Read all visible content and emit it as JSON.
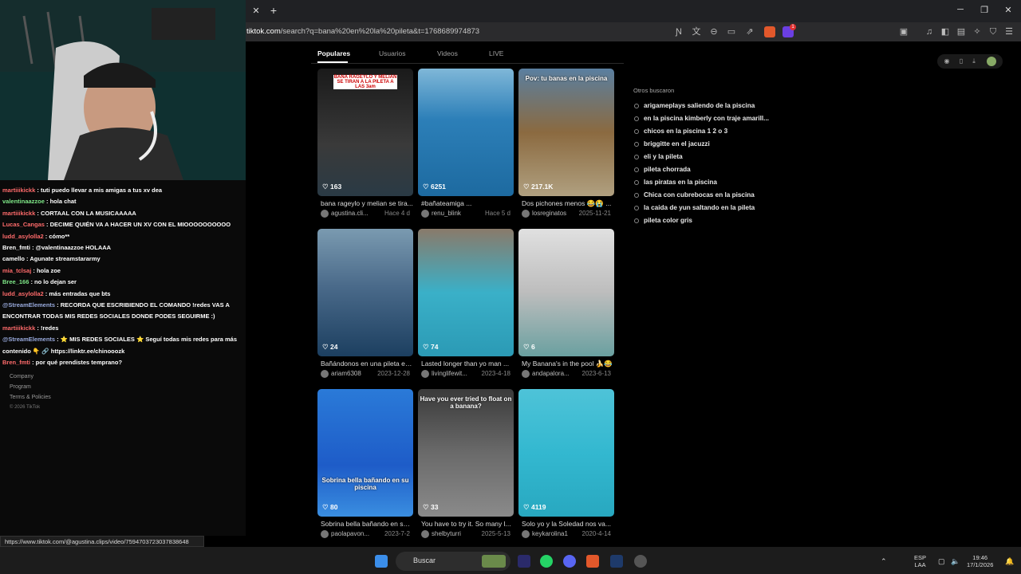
{
  "browser": {
    "url_domain": "tiktok.com",
    "url_rest": "/search?q=bana%20en%20la%20pileta&t=1768689974873",
    "status_url": "https://www.tiktok.com/@agustina.clips/video/7594703723037838648",
    "rewards_count": "1"
  },
  "tabs": [
    "Populares",
    "Usuarios",
    "Videos",
    "LIVE"
  ],
  "cards": [
    {
      "likes": "163",
      "title": "bana rageylo y melian se tira...",
      "author": "agustina.cli...",
      "date": "Hace 4 d",
      "caption": "BANA RAGEYLO Y MELIAN SE TIRAN A LA PILETA A LAS 3am"
    },
    {
      "likes": "6251",
      "title": "#bañateamiga ...",
      "author": "renu_blink",
      "date": "Hace 5 d",
      "caption": ""
    },
    {
      "likes": "217.1K",
      "title": "Dos pichones menos 😂😭 ...",
      "author": "losreginatos",
      "date": "2025-11-21",
      "caption": "Pov: tu banas en la piscina"
    },
    {
      "likes": "24",
      "title": "Bañándonos en una pileta es...",
      "author": "ariam6308",
      "date": "2023-12-28",
      "caption": ""
    },
    {
      "likes": "74",
      "title": "Lasted longer than yo man ...",
      "author": "livinglifewit...",
      "date": "2023-4-18",
      "caption": ""
    },
    {
      "likes": "6",
      "title": "My Banana's in the pool 🍌😂",
      "author": "andapalora...",
      "date": "2023-6-13",
      "caption": ""
    },
    {
      "likes": "80",
      "title": "Sobrina bella bañando en su piscina",
      "author": "paolapavon...",
      "date": "2023-7-2",
      "caption": "Sobrina bella bañando en su piscina"
    },
    {
      "likes": "33",
      "title": "You have to try it. So many l...",
      "author": "shelbyturri",
      "date": "2025-5-13",
      "caption": "Have you ever tried to float on a banana?"
    },
    {
      "likes": "4119",
      "title": "Solo yo y la Soledad nos va...",
      "author": "keykarolina1",
      "date": "2020-4-14",
      "caption": ""
    }
  ],
  "related": {
    "heading": "Otros buscaron",
    "items": [
      "arigameplays saliendo de la piscina",
      "en la piscina kimberly con traje amarill...",
      "chicos en la piscina 1 2 o 3",
      "briggitte en el jacuzzi",
      "eli y la pileta",
      "pileta chorrada",
      "las piratas en la piscina",
      "Chica con cubrebocas en la piscina",
      "la caida de yun saltando en la pileta",
      "pileta color gris"
    ]
  },
  "chat": [
    {
      "user": "martiiikickk",
      "msg": ": tuti puedo llevar a mis amigas a tus xv dea"
    },
    {
      "user": "valentinaazzoe",
      "msg": ": hola chat"
    },
    {
      "user": "martiiikickk",
      "msg": ": CORTAAL CON LA MUSICAAAAA"
    },
    {
      "user": "Lucas_Cangas",
      "msg": ": DECIME QUIÉN VA A HACER UN XV CON EL MIOOOOOOOOOO"
    },
    {
      "user": "ludd_asylolla2",
      "msg": ": cómo**"
    },
    {
      "user": "Bren_fmti",
      "msg": ": @valentinaazzoe HOLAAA"
    },
    {
      "user": "camello",
      "msg": ": Agunate streamstararmy"
    },
    {
      "user": "mia_tclsaj",
      "msg": ": hola zoe"
    },
    {
      "user": "Bree_166",
      "msg": ": no lo dejan ser"
    },
    {
      "user": "ludd_asylolla2",
      "msg": ": más entradas que bts"
    },
    {
      "user": "@StreamElements",
      "msg": ": RECORDA QUE ESCRIBIENDO EL COMANDO !redes VAS A"
    },
    {
      "user": "",
      "msg": "ENCONTRAR TODAS MIS REDES SOCIALES DONDE PODES SEGUIRME :)"
    },
    {
      "user": "martiiikickk",
      "msg": ": !redes"
    },
    {
      "user": "@StreamElements",
      "msg": ": ⭐ MIS REDES SOCIALES ⭐ Seguí todas mis redes para más"
    },
    {
      "user": "",
      "msg": "contenido 👇 🔗 https://linktr.ee/chinooozk"
    },
    {
      "user": "Bren_fmti",
      "msg": ": por qué prendistes temprano?"
    }
  ],
  "footer": [
    "Company",
    "Program",
    "Terms & Policies",
    "© 2026 TikTok"
  ],
  "taskbar": {
    "search": "Buscar",
    "lang1": "ESP",
    "lang2": "LAA",
    "time": "19:46",
    "date": "17/1/2026"
  },
  "colors": {
    "accent": "#fe2c55",
    "background": "#000000"
  }
}
